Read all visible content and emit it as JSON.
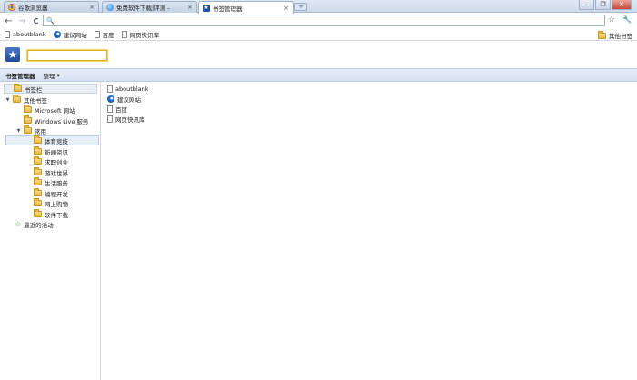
{
  "tabs": [
    {
      "title": "谷歌浏览器",
      "favicon": "chrome-icon"
    },
    {
      "title": "免费软件下载|评测 -",
      "favicon": "globe-icon"
    },
    {
      "title": "书签管理器",
      "favicon": "bookmark-star-icon",
      "active": true
    }
  ],
  "toolbar": {
    "back": "←",
    "forward": "→",
    "reload": "C",
    "omnibox_value": "",
    "star": "☆",
    "wrench": "🔧"
  },
  "bookmarks_bar": {
    "items": [
      {
        "label": "aboutblank",
        "icon": "page-icon"
      },
      {
        "label": "建议网站",
        "icon": "ie-icon"
      },
      {
        "label": "百度",
        "icon": "page-icon"
      },
      {
        "label": "网页快讯库",
        "icon": "page-icon"
      }
    ],
    "other": "其他书签"
  },
  "manager": {
    "search_value": "",
    "title": "书签管理器",
    "organize": "整理",
    "organize_arrow": "▾"
  },
  "tree": {
    "root": "书签栏",
    "other": "其他书签",
    "microsoft": "Microsoft 网站",
    "windows_live": "Windows Live 服务",
    "common": "常用",
    "children": [
      "体育竞技",
      "新闻资讯",
      "求职创业",
      "游戏世界",
      "生活服务",
      "编程开发",
      "网上购物",
      "软件下载"
    ],
    "recent": "最近的活动"
  },
  "list": [
    {
      "label": "aboutblank",
      "icon": "page-icon"
    },
    {
      "label": "建议网站",
      "icon": "ie-icon"
    },
    {
      "label": "百度",
      "icon": "page-icon"
    },
    {
      "label": "网页快讯库",
      "icon": "page-icon"
    }
  ],
  "colors": {
    "accent": "#1f4b99",
    "folder": "#e8b640",
    "selection": "#e6eef9"
  }
}
